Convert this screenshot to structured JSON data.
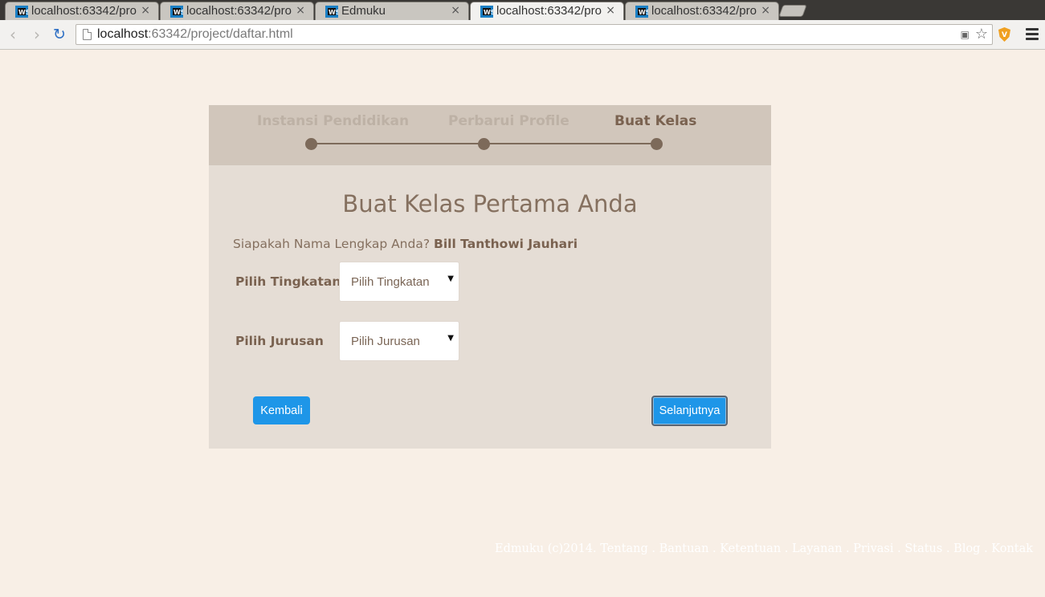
{
  "browser": {
    "tabs": [
      {
        "title": "localhost:63342/pro",
        "active": false
      },
      {
        "title": "localhost:63342/pro",
        "active": false
      },
      {
        "title": "Edmuku",
        "active": false
      },
      {
        "title": "localhost:63342/pro",
        "active": true
      },
      {
        "title": "localhost:63342/pro",
        "active": false
      }
    ],
    "tab_close": "×",
    "url_host": "localhost",
    "url_rest": ":63342/project/daftar.html",
    "back_glyph": "‹",
    "forward_glyph": "›",
    "reload_glyph": "↻",
    "star_glyph": "☆",
    "translate_glyph": "▣"
  },
  "steps": [
    {
      "label": "Instansi Pendidikan",
      "state": "done"
    },
    {
      "label": "Perbarui Profile",
      "state": "done"
    },
    {
      "label": "Buat Kelas",
      "state": "current"
    }
  ],
  "form": {
    "title": "Buat Kelas Pertama Anda",
    "name_question": "Siapakah Nama Lengkap Anda?",
    "name_value": "Bill Tanthowi Jauhari",
    "level_label": "Pilih Tingkatan",
    "level_selected": "Pilih Tingkatan",
    "major_label": "Pilih Jurusan",
    "major_selected": "Pilih Jurusan",
    "caret": "▼",
    "back_button": "Kembali",
    "next_button": "Selanjutnya"
  },
  "footer": {
    "text": "Edmuku (c)2014. Tentang . Bantuan . Ketentuan . Layanan . Privasi . Status . Blog . Kontak"
  },
  "colors": {
    "page_bg": "#f8efe6",
    "card_bg": "#e5ddd5",
    "steps_bg": "#d1c6bb",
    "accent_button": "#1e96e8",
    "text_brown": "#7a6250"
  },
  "icons": {
    "tab_favicon": "webstorm-icon",
    "extension": "shield-extension-icon",
    "menu": "hamburger-menu-icon"
  }
}
